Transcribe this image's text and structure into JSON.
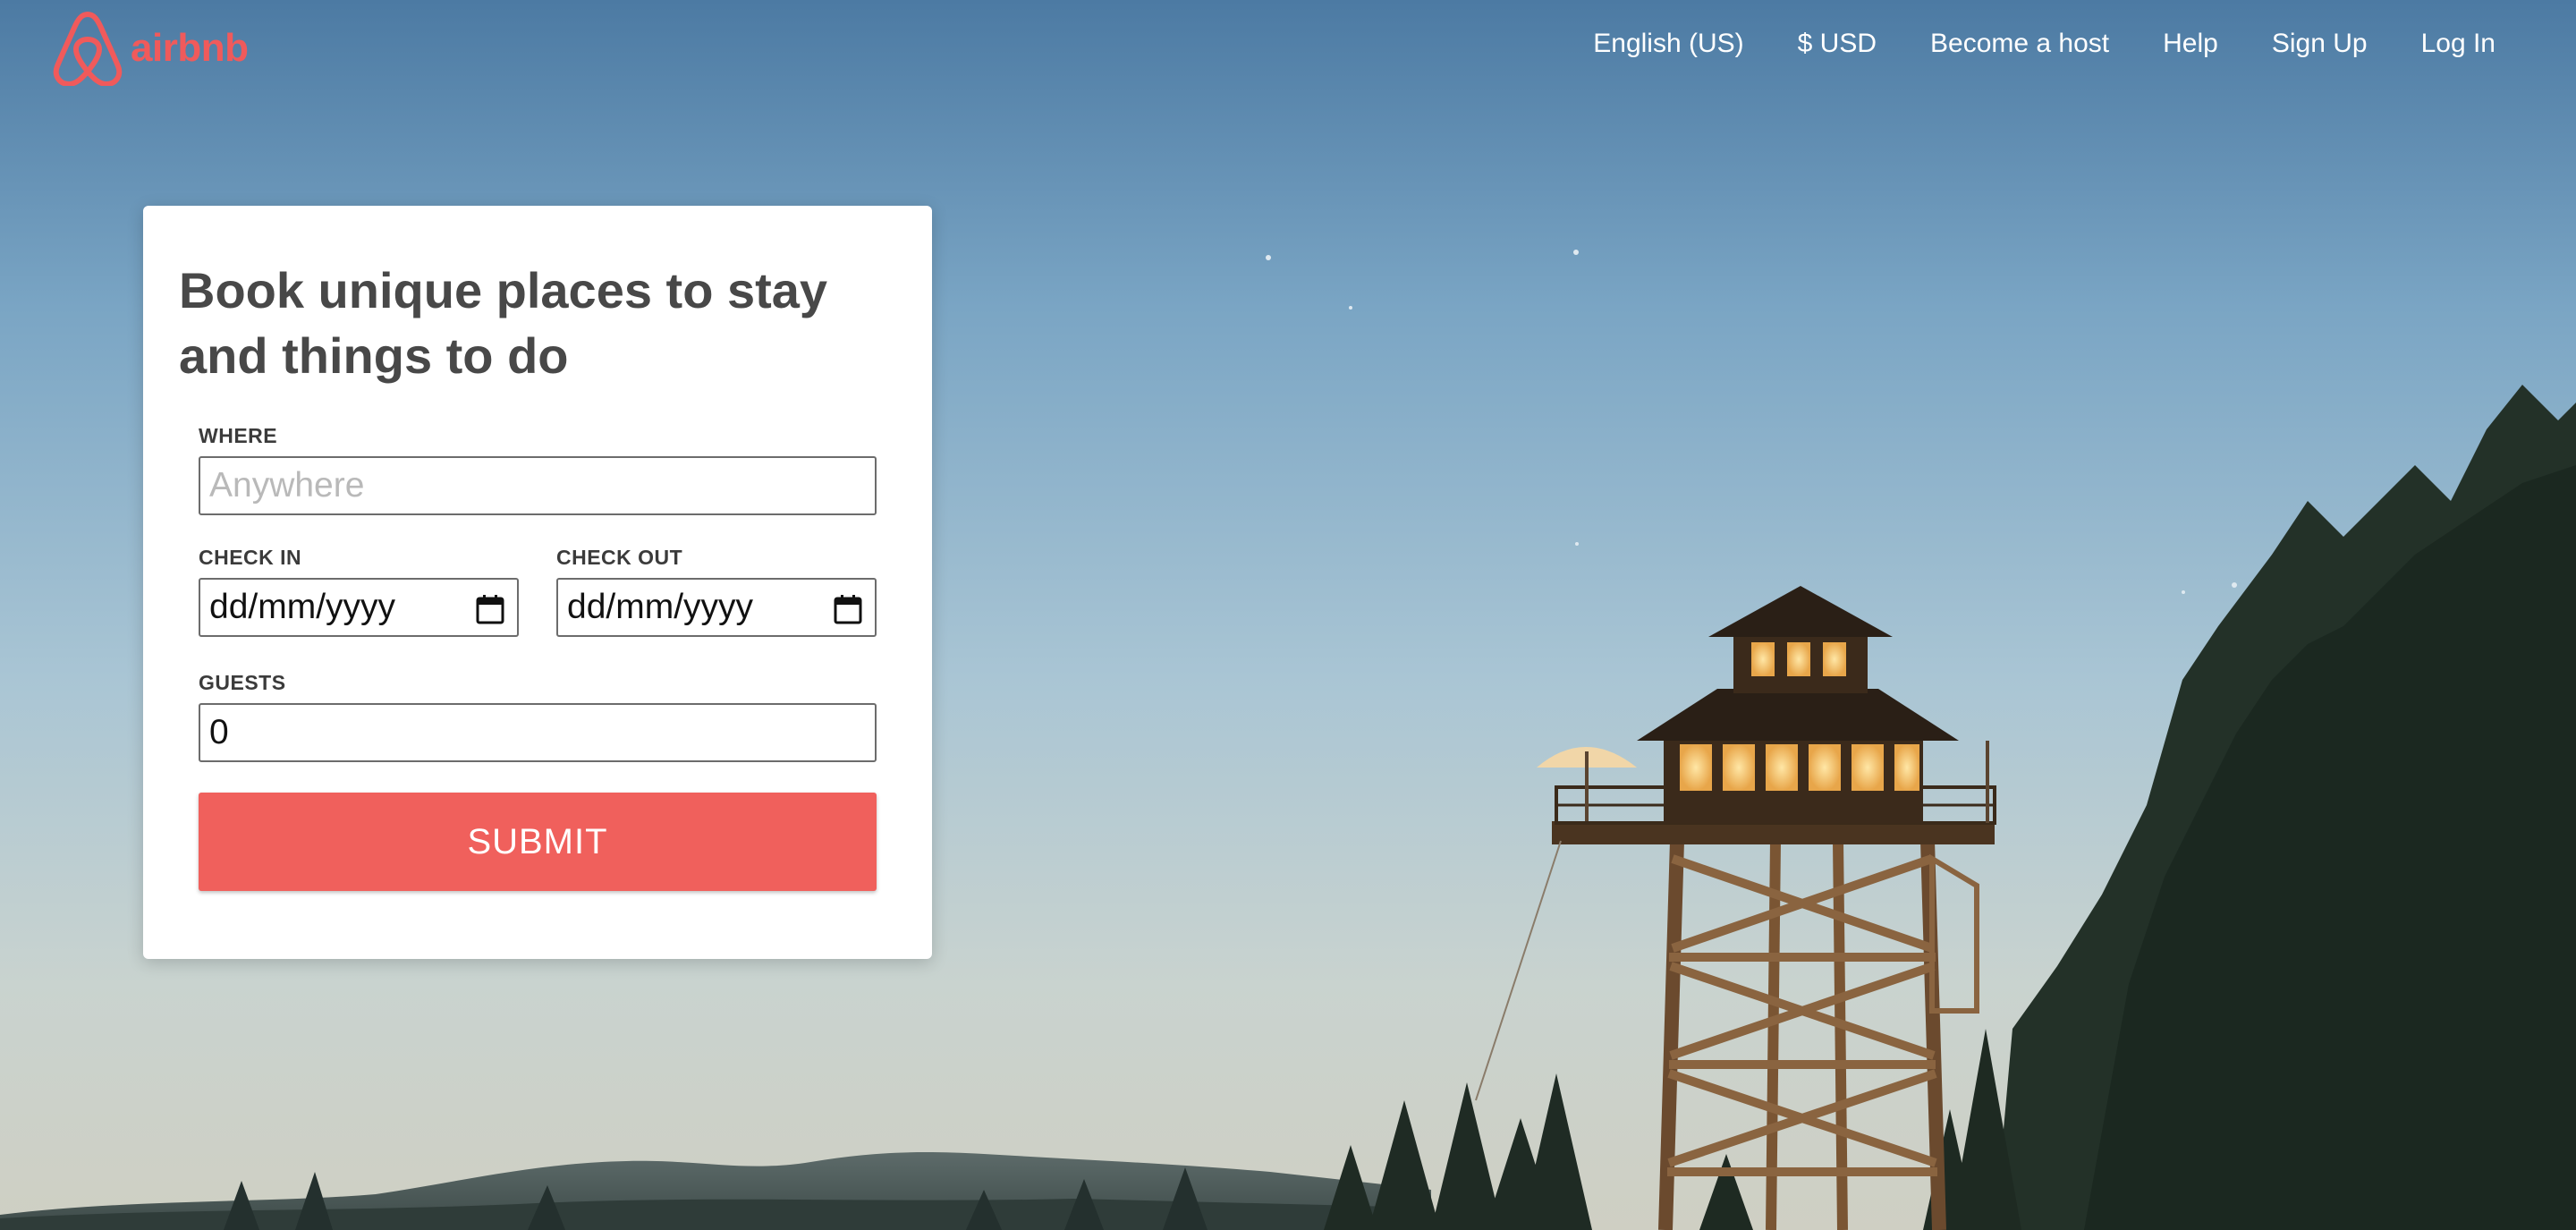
{
  "header": {
    "logo_text": "airbnb",
    "nav": [
      {
        "label": "English (US)"
      },
      {
        "label": "$ USD"
      },
      {
        "label": "Become a host"
      },
      {
        "label": "Help"
      },
      {
        "label": "Sign Up"
      },
      {
        "label": "Log In"
      }
    ]
  },
  "search_card": {
    "title": "Book unique places to stay and things to do",
    "where": {
      "label": "WHERE",
      "placeholder": "Anywhere",
      "value": ""
    },
    "check_in": {
      "label": "CHECK IN",
      "value": "dd/mm/yyyy"
    },
    "check_out": {
      "label": "CHECK OUT",
      "value": "dd/mm/yyyy"
    },
    "guests": {
      "label": "GUESTS",
      "value": "0"
    },
    "submit_label": "SUBMIT"
  },
  "colors": {
    "brand": "#f05a5b",
    "button": "#f0605c",
    "title_text": "#484848"
  },
  "icons": {
    "logo": "airbnb-belo-icon",
    "date": "calendar-icon"
  }
}
